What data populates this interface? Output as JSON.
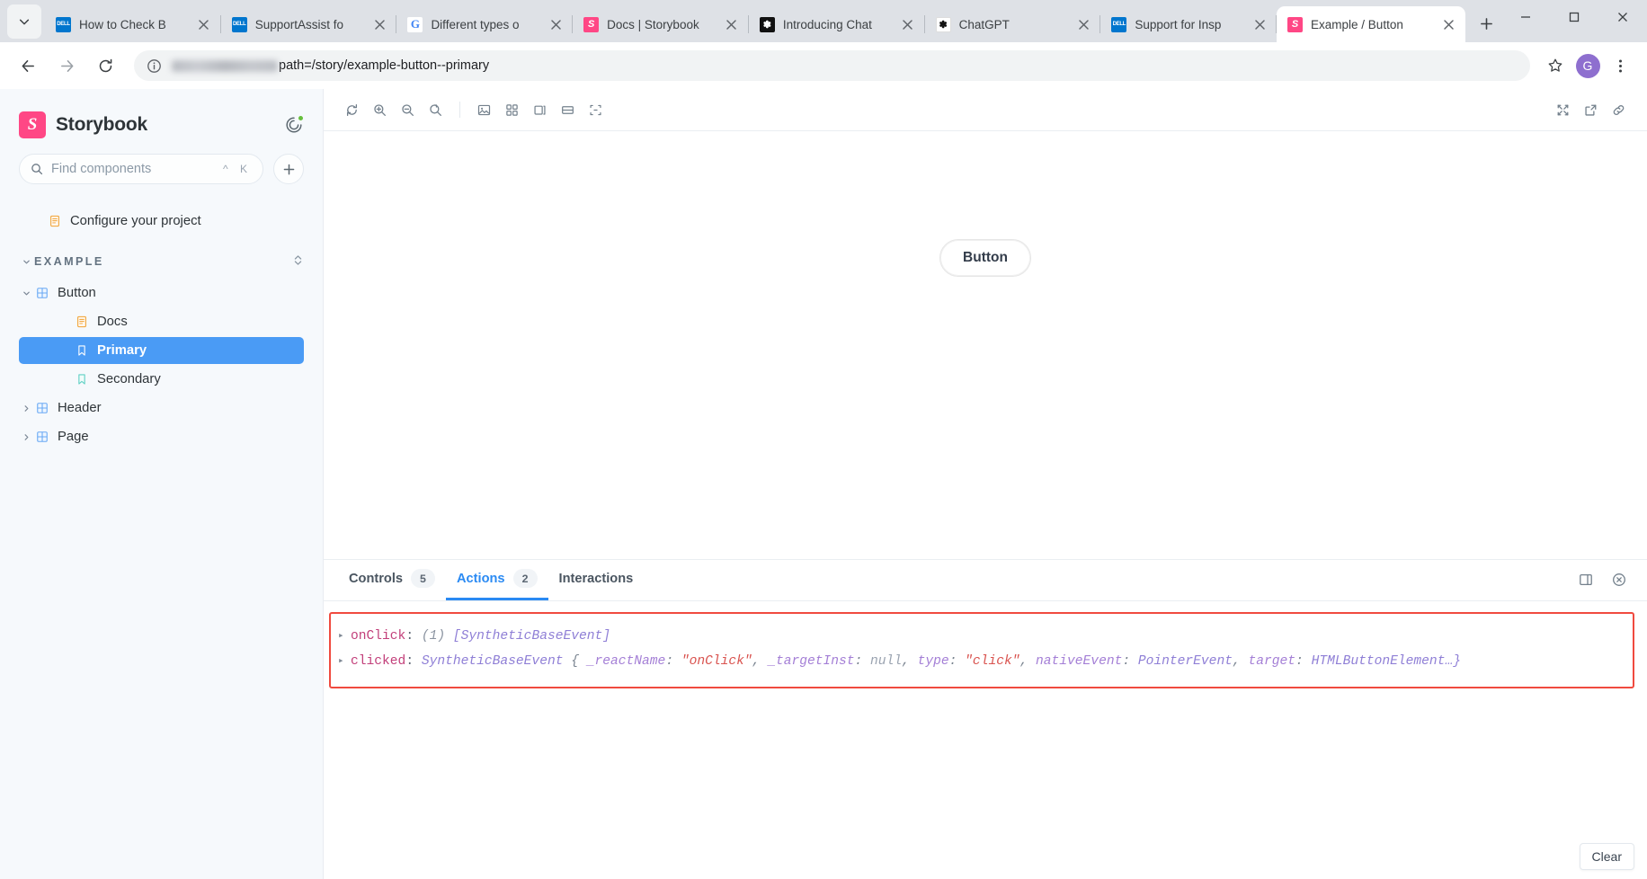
{
  "browser": {
    "tabs": [
      {
        "title": "How to Check B",
        "favicon": "dell-favicon",
        "favicon_text": "DELL",
        "active": false
      },
      {
        "title": "SupportAssist fo",
        "favicon": "dell-favicon",
        "favicon_text": "DELL",
        "active": false
      },
      {
        "title": "Different types o",
        "favicon": "google-favicon",
        "favicon_text": "G",
        "active": false
      },
      {
        "title": "Docs | Storybook",
        "favicon": "storybook-favicon",
        "favicon_text": "S",
        "active": false
      },
      {
        "title": "Introducing Chat",
        "favicon": "openai-dark-favicon",
        "favicon_text": "✽",
        "active": false
      },
      {
        "title": "ChatGPT",
        "favicon": "openai-light-favicon",
        "favicon_text": "✽",
        "active": false
      },
      {
        "title": "Support for Insp",
        "favicon": "dell-favicon",
        "favicon_text": "DELL",
        "active": false
      },
      {
        "title": "Example / Button",
        "favicon": "storybook-favicon",
        "favicon_text": "S",
        "active": true
      }
    ],
    "new_tab_label": "+",
    "window_controls": {
      "minimize": "minimize-button",
      "maximize": "maximize-button",
      "close": "close-button"
    },
    "nav": {
      "back": "back-button",
      "forward": "forward-button",
      "reload": "reload-button"
    },
    "omnibox": {
      "site_info": "site-information-icon",
      "url_visible_text": "path=/story/example-button--primary",
      "url_redacted": true
    },
    "bookmark_label": "bookmark-star",
    "profile_initial": "G",
    "menu_label": "browser-menu"
  },
  "storybook": {
    "brand": {
      "name": "Storybook",
      "logo_glyph": "S"
    },
    "version_status": "up-to-date",
    "search": {
      "placeholder": "Find components",
      "value": "",
      "shortcut": "^ K"
    },
    "add_button_label": "+",
    "tree": [
      {
        "id": "configure-your-project",
        "label": "Configure your project",
        "type": "document",
        "indent": 1,
        "caret": "none",
        "selected": false
      },
      {
        "id": "example",
        "label": "EXAMPLE",
        "type": "group",
        "indent": 0,
        "caret": "down",
        "selected": false
      },
      {
        "id": "button",
        "label": "Button",
        "type": "component",
        "indent": 0,
        "caret": "down",
        "selected": false
      },
      {
        "id": "button-docs",
        "label": "Docs",
        "type": "document",
        "indent": 2,
        "caret": "none",
        "selected": false
      },
      {
        "id": "button-primary",
        "label": "Primary",
        "type": "story",
        "indent": 2,
        "caret": "none",
        "selected": true
      },
      {
        "id": "button-secondary",
        "label": "Secondary",
        "type": "story",
        "indent": 2,
        "caret": "none",
        "selected": false
      },
      {
        "id": "header",
        "label": "Header",
        "type": "component",
        "indent": 0,
        "caret": "right",
        "selected": false
      },
      {
        "id": "page",
        "label": "Page",
        "type": "component",
        "indent": 0,
        "caret": "right",
        "selected": false
      }
    ],
    "canvas_toolbar": {
      "left": [
        {
          "id": "remount",
          "name": "remount-icon"
        },
        {
          "id": "zoom-in",
          "name": "zoom-in-icon"
        },
        {
          "id": "zoom-out",
          "name": "zoom-out-icon"
        },
        {
          "id": "zoom-reset",
          "name": "zoom-reset-icon"
        },
        {
          "id": "backgrounds",
          "name": "backgrounds-icon"
        },
        {
          "id": "grid",
          "name": "grid-icon"
        },
        {
          "id": "viewport",
          "name": "viewport-icon"
        },
        {
          "id": "measure",
          "name": "measure-icon"
        },
        {
          "id": "outline",
          "name": "outline-icon"
        }
      ],
      "right": [
        {
          "id": "fullscreen",
          "name": "fullscreen-icon"
        },
        {
          "id": "open-new-tab",
          "name": "open-in-new-tab-icon"
        },
        {
          "id": "copy-link",
          "name": "copy-link-icon"
        }
      ]
    },
    "story": {
      "button_label": "Button"
    },
    "panel": {
      "tabs": [
        {
          "id": "controls",
          "label": "Controls",
          "badge": "5",
          "active": false
        },
        {
          "id": "actions",
          "label": "Actions",
          "badge": "2",
          "active": true
        },
        {
          "id": "interactions",
          "label": "Interactions",
          "badge": "",
          "active": false
        }
      ],
      "tools": [
        {
          "id": "panel-position",
          "name": "panel-position-icon"
        },
        {
          "id": "panel-close",
          "name": "panel-close-icon"
        }
      ],
      "actions_log": [
        {
          "arrow": "▸",
          "key": "onClick",
          "tokens": [
            {
              "text": "(1)",
              "kind": "count"
            },
            {
              "text": "[SyntheticBaseEvent]",
              "kind": "type"
            }
          ]
        },
        {
          "arrow": "▸",
          "key": "clicked",
          "tokens": [
            {
              "text": "SyntheticBaseEvent",
              "kind": "type"
            },
            {
              "text": "{",
              "kind": "plain"
            },
            {
              "text": "_reactName",
              "kind": "prop"
            },
            {
              "text": ":",
              "kind": "plain"
            },
            {
              "text": "\"onClick\"",
              "kind": "str"
            },
            {
              "text": ",",
              "kind": "plain"
            },
            {
              "text": "_targetInst",
              "kind": "prop"
            },
            {
              "text": ":",
              "kind": "plain"
            },
            {
              "text": "null",
              "kind": "null"
            },
            {
              "text": ",",
              "kind": "plain"
            },
            {
              "text": "type",
              "kind": "prop"
            },
            {
              "text": ":",
              "kind": "plain"
            },
            {
              "text": "\"click\"",
              "kind": "str"
            },
            {
              "text": ",",
              "kind": "plain"
            },
            {
              "text": "nativeEvent",
              "kind": "prop"
            },
            {
              "text": ":",
              "kind": "plain"
            },
            {
              "text": "PointerEvent",
              "kind": "type"
            },
            {
              "text": ",",
              "kind": "plain"
            },
            {
              "text": "target",
              "kind": "prop"
            },
            {
              "text": ":",
              "kind": "plain"
            },
            {
              "text": "HTMLButtonElement…}",
              "kind": "type"
            }
          ]
        }
      ],
      "clear_label": "Clear",
      "highlight_color": "#f04a3f"
    },
    "accent_color": "#ff4785",
    "selection_color": "#4a9bf5",
    "active_tab_color": "#2a8af3"
  }
}
